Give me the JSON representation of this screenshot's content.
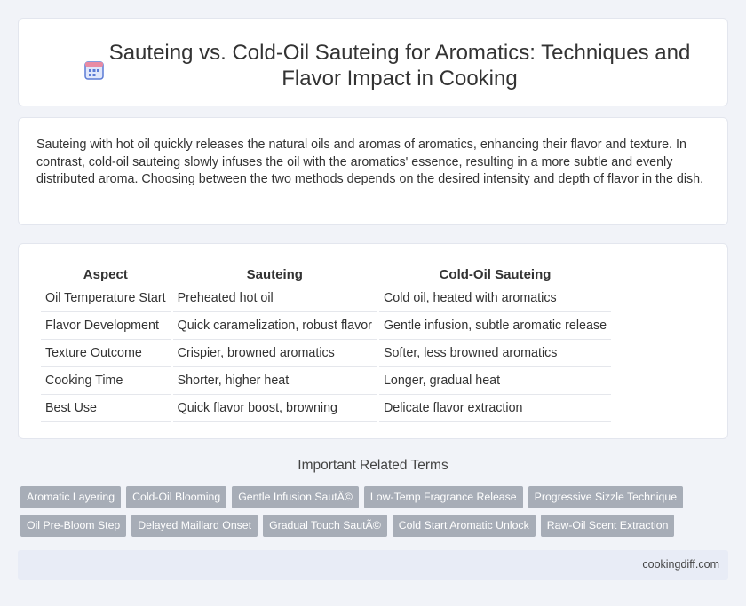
{
  "header": {
    "icon": "calendar-icon",
    "title": "Sauteing vs. Cold-Oil Sauteing for Aromatics: Techniques and Flavor Impact in Cooking"
  },
  "intro": {
    "text": "Sauteing with hot oil quickly releases the natural oils and aromas of aromatics, enhancing their flavor and texture. In contrast, cold-oil sauteing slowly infuses the oil with the aromatics' essence, resulting in a more subtle and evenly distributed aroma. Choosing between the two methods depends on the desired intensity and depth of flavor in the dish."
  },
  "table": {
    "headers": [
      "Aspect",
      "Sauteing",
      "Cold-Oil Sauteing"
    ],
    "rows": [
      [
        "Oil Temperature Start",
        "Preheated hot oil",
        "Cold oil, heated with aromatics"
      ],
      [
        "Flavor Development",
        "Quick caramelization, robust flavor",
        "Gentle infusion, subtle aromatic release"
      ],
      [
        "Texture Outcome",
        "Crispier, browned aromatics",
        "Softer, less browned aromatics"
      ],
      [
        "Cooking Time",
        "Shorter, higher heat",
        "Longer, gradual heat"
      ],
      [
        "Best Use",
        "Quick flavor boost, browning",
        "Delicate flavor extraction"
      ]
    ]
  },
  "related": {
    "title": "Important Related Terms",
    "row1": [
      "Aromatic Layering",
      "Cold-Oil Blooming",
      "Gentle Infusion SautÃ©",
      "Low-Temp Fragrance Release",
      "Progressive Sizzle Technique"
    ],
    "row2": [
      "Oil Pre-Bloom Step",
      "Delayed Maillard Onset",
      "Gradual Touch SautÃ©",
      "Cold Start Aromatic Unlock",
      "Raw-Oil Scent Extraction"
    ]
  },
  "footer": {
    "site": "cookingdiff.com"
  },
  "colors": {
    "background": "#f1f3f8",
    "tag": "#a7adb7",
    "footer": "#e8ecf6",
    "icon_blue": "#5b7bd5",
    "icon_pink": "#e88ba4"
  }
}
